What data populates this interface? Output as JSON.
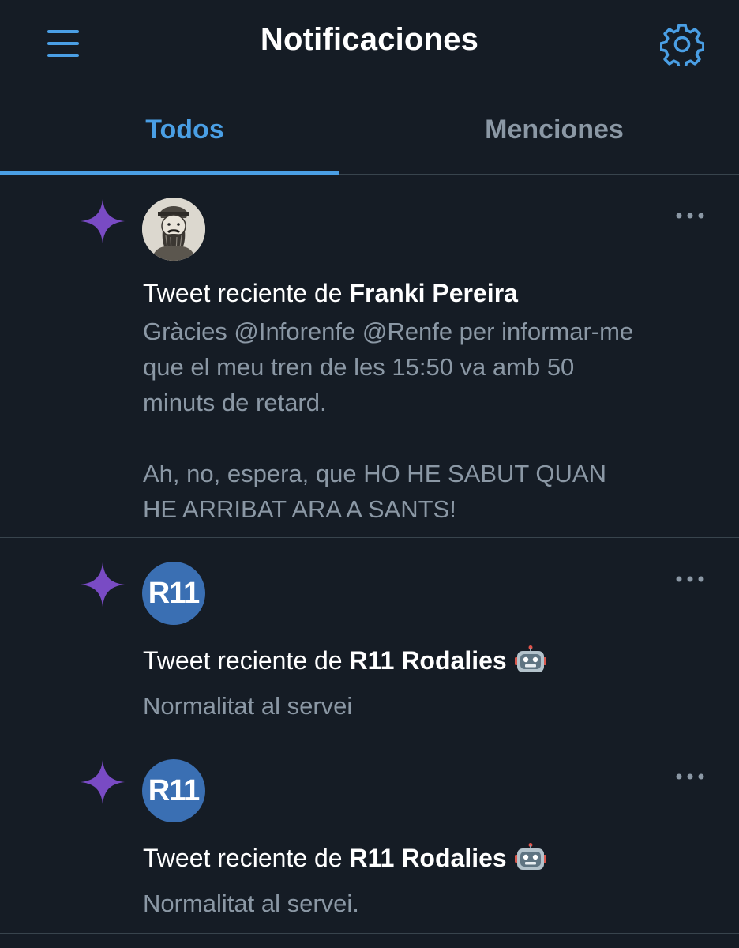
{
  "header": {
    "title": "Notificaciones",
    "menu_icon": "menu-icon",
    "settings_icon": "gear-icon"
  },
  "tabs": [
    {
      "label": "Todos",
      "active": true
    },
    {
      "label": "Menciones",
      "active": false
    }
  ],
  "colors": {
    "background": "#151c25",
    "accent": "#4a9fe5",
    "sparkle": "#794bc4",
    "muted_text": "#8b98a5",
    "divider": "#38444d",
    "r11_avatar": "#3a6fb3"
  },
  "notifications": [
    {
      "icon": "sparkle-icon",
      "avatar_type": "illustration",
      "prefix": "Tweet reciente de ",
      "name": "Franki Pereira",
      "robot_emoji": false,
      "text_lines": [
        "Gràcies @Inforenfe @Renfe per informar-me",
        "que el meu tren de les 15:50 va amb 50",
        "minuts de retard.",
        "",
        "Ah, no, espera, que HO HE SABUT QUAN",
        "HE ARRIBAT ARA A SANTS!"
      ]
    },
    {
      "icon": "sparkle-icon",
      "avatar_text": "R11",
      "prefix": "Tweet reciente de ",
      "name": "R11 Rodalies",
      "robot_emoji": true,
      "text": "Normalitat al servei"
    },
    {
      "icon": "sparkle-icon",
      "avatar_text": "R11",
      "prefix": "Tweet reciente de ",
      "name": "R11 Rodalies",
      "robot_emoji": true,
      "text": "Normalitat al servei."
    }
  ]
}
